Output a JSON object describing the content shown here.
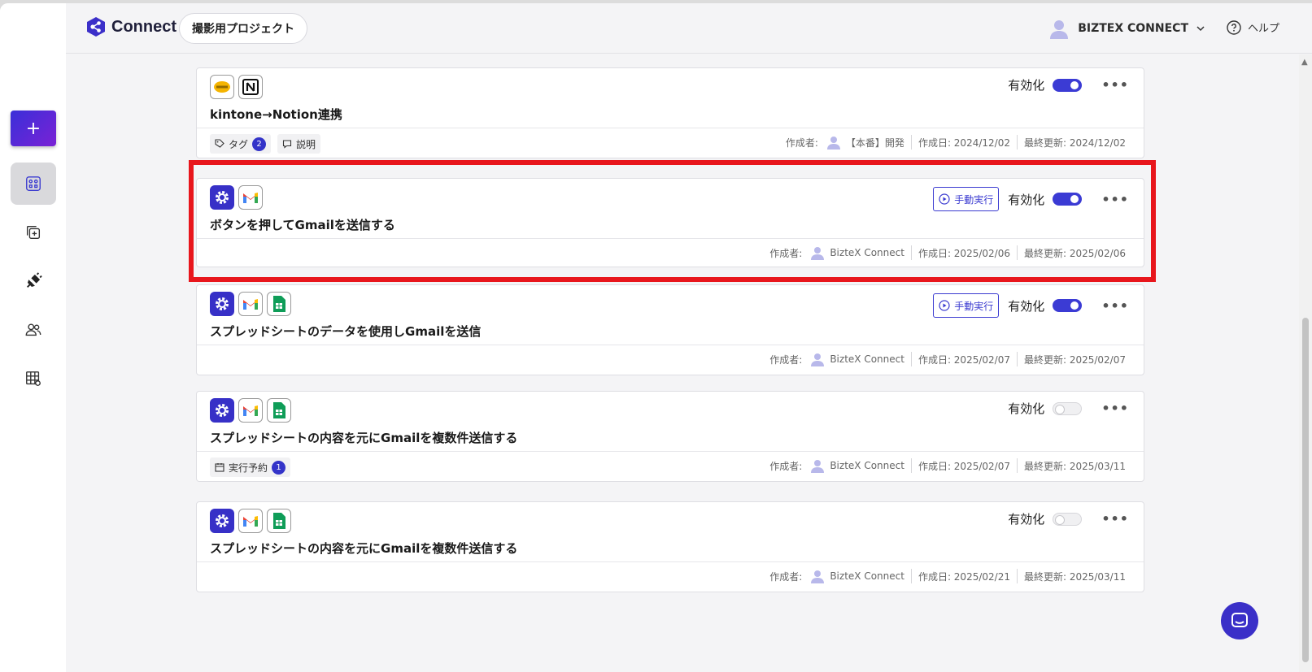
{
  "header": {
    "app_name": "Connect",
    "project": "撮影用プロジェクト",
    "user": "BIZTEX CONNECT",
    "help": "ヘルプ"
  },
  "sidebar": {
    "new_label": "+",
    "items": [
      "robots-icon",
      "copy-add-icon",
      "plug-icon",
      "users-icon",
      "table-settings-icon"
    ]
  },
  "common": {
    "enable_label": "有効化",
    "run_label": "手動実行",
    "author_label": "作成者:",
    "more": "•••"
  },
  "cards": [
    {
      "title": "kintone→Notion連携",
      "icons": [
        "kintone-icon",
        "notion-icon"
      ],
      "enabled": true,
      "manual_run": false,
      "chips": [
        {
          "label": "タグ",
          "count": "2"
        },
        {
          "label": "説明",
          "count": ""
        }
      ],
      "author": "【本番】開発",
      "created": "作成日: 2024/12/02",
      "updated": "最終更新: 2024/12/02"
    },
    {
      "title": "ボタンを押してGmailを送信する",
      "icons": [
        "gear-icon",
        "gmail-icon"
      ],
      "enabled": true,
      "manual_run": true,
      "chips": [],
      "author": "BizteX Connect",
      "created": "作成日: 2025/02/06",
      "updated": "最終更新: 2025/02/06"
    },
    {
      "title": "スプレッドシートのデータを使用しGmailを送信",
      "icons": [
        "gear-icon",
        "gmail-icon",
        "sheets-icon"
      ],
      "enabled": true,
      "manual_run": true,
      "chips": [],
      "author": "BizteX Connect",
      "created": "作成日: 2025/02/07",
      "updated": "最終更新: 2025/02/07"
    },
    {
      "title": "スプレッドシートの内容を元にGmailを複数件送信する",
      "icons": [
        "gear-icon",
        "gmail-icon",
        "sheets-icon"
      ],
      "enabled": false,
      "manual_run": false,
      "chips": [
        {
          "label": "実行予約",
          "count": "1"
        }
      ],
      "author": "BizteX Connect",
      "created": "作成日: 2025/02/07",
      "updated": "最終更新: 2025/03/11"
    },
    {
      "title": "スプレッドシートの内容を元にGmailを複数件送信する",
      "icons": [
        "gear-icon",
        "gmail-icon",
        "sheets-icon"
      ],
      "enabled": false,
      "manual_run": false,
      "chips": [],
      "author": "BizteX Connect",
      "created": "作成日: 2025/02/21",
      "updated": "最終更新: 2025/03/11"
    }
  ],
  "colors": {
    "accent": "#3b3bd4",
    "highlight": "#e8161c"
  }
}
